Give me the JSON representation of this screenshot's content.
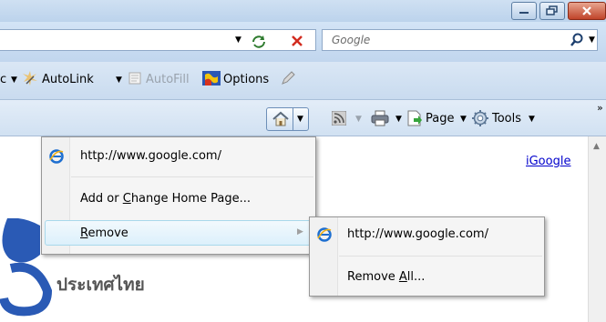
{
  "browser": {
    "search_placeholder": "Google"
  },
  "links_bar": {
    "cut_label": "c",
    "autolink_label": "AutoLink",
    "autofill_label": "AutoFill",
    "options_label": "Options"
  },
  "command_bar": {
    "page_label": "Page",
    "tools_label": "Tools",
    "overflow": "»"
  },
  "home_menu": {
    "items": [
      {
        "label": "http://www.google.com/"
      },
      {
        "label": "Add or Change Home Page..."
      },
      {
        "label": "Remove"
      }
    ],
    "change_mnemonic": "C",
    "remove_mnemonic": "R"
  },
  "remove_submenu": {
    "items": [
      {
        "label": "http://www.google.com/"
      },
      {
        "label": "Remove All..."
      }
    ],
    "all_mnemonic": "A"
  },
  "page": {
    "igoogle_link": "iGoogle",
    "logo_subtitle": "ประเทศไทย"
  },
  "colors": {
    "accent": "#3c6fb5",
    "close_red": "#c0442a",
    "link": "#0000cc"
  }
}
